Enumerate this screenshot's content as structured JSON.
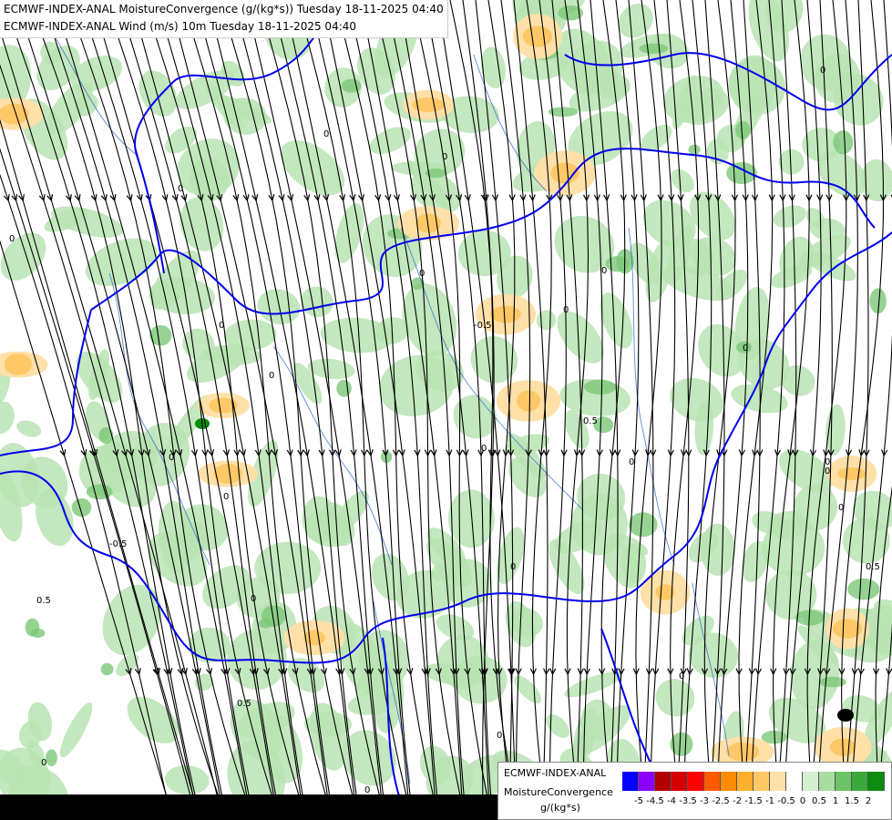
{
  "titles": {
    "line1": "ECMWF-INDEX-ANAL MoistureConvergence (g/(kg*s)) Tuesday 18-11-2025 04:40",
    "line2": "ECMWF-INDEX-ANAL Wind (m/s) 10m Tuesday 18-11-2025 04:40"
  },
  "legend": {
    "name_line1": "ECMWF-INDEX-ANAL",
    "name_line2": "MoistureConvergence",
    "unit": "g/(kg*s)",
    "colors": [
      "#0000ff",
      "#8b00ff",
      "#b20000",
      "#d40000",
      "#ff0000",
      "#ff5a00",
      "#ff8c00",
      "#ffae2e",
      "#ffc866",
      "#ffe0a8",
      "#ffffff",
      "#d4efd0",
      "#a8dca0",
      "#6cc266",
      "#3aa83a",
      "#0c8c0c"
    ],
    "tick_labels": [
      "-5",
      "-4.5",
      "-4",
      "-3.5",
      "-3",
      "-2.5",
      "-2",
      "-1.5",
      "-1",
      "-0.5",
      "0",
      "0.5",
      "1",
      "1.5",
      "2"
    ]
  },
  "contour_labels": [
    "0.5",
    "0",
    "0",
    "0",
    "0",
    "-0.5",
    "0",
    "0",
    "0",
    "0",
    "0",
    "0",
    "-0.5",
    "0",
    "0.5",
    "0",
    "0.5",
    "0",
    "0",
    "0",
    "0",
    "0",
    "0",
    "0",
    "0",
    "0",
    "0",
    "0",
    "0.5",
    "0"
  ],
  "map_colors": {
    "land": "#ffffff",
    "convergence_green": "#b9e3b3",
    "convergence_green_dark": "#7cc878",
    "divergence_orange": "#ffc866",
    "divergence_orange_light": "#ffe0a8",
    "border_blue": "#0000ee",
    "river_blue": "#2a5fd0",
    "streamline": "#000000"
  }
}
